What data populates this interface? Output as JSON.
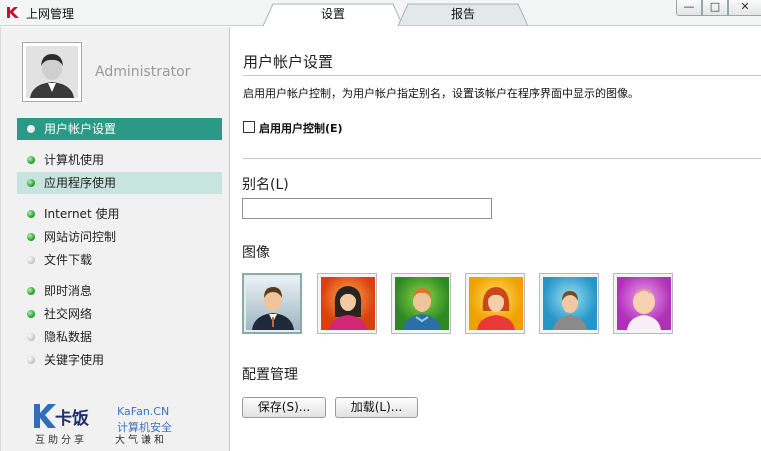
{
  "window": {
    "title": "上网管理",
    "controls": {
      "minimize": "—",
      "maximize": "□",
      "close": "✕"
    }
  },
  "tabs": [
    {
      "label": "设置",
      "active": true
    },
    {
      "label": "报告",
      "active": false
    }
  ],
  "sidebar": {
    "user_name": "Administrator",
    "items": [
      {
        "label": "用户帐户设置",
        "status": "white",
        "state": "active"
      },
      {
        "label": "计算机使用",
        "status": "green",
        "state": "normal"
      },
      {
        "label": "应用程序使用",
        "status": "green",
        "state": "highlighted"
      },
      {
        "label": "Internet 使用",
        "status": "green",
        "state": "normal"
      },
      {
        "label": "网站访问控制",
        "status": "green",
        "state": "normal"
      },
      {
        "label": "文件下载",
        "status": "gray",
        "state": "normal"
      },
      {
        "label": "即时消息",
        "status": "green",
        "state": "normal"
      },
      {
        "label": "社交网络",
        "status": "green",
        "state": "normal"
      },
      {
        "label": "隐私数据",
        "status": "gray",
        "state": "normal"
      },
      {
        "label": "关键字使用",
        "status": "gray",
        "state": "normal"
      }
    ],
    "logo": {
      "cn": "卡饭",
      "en": "KaFan.CN",
      "sub": "计算机安全",
      "motto_left": "互助分享",
      "motto_right": "大气谦和"
    }
  },
  "main": {
    "section_title": "用户帐户设置",
    "description": "启用用户帐户控制，为用户帐户指定别名，设置该帐户在程序界面中显示的图像。",
    "enable_checkbox": {
      "label": "启用用户控制(E)",
      "checked": false
    },
    "alias": {
      "label": "别名(L)",
      "value": ""
    },
    "image_label": "图像",
    "avatars": [
      {
        "name": "businessman-avatar",
        "bg": "#b8c8d0",
        "selected": true
      },
      {
        "name": "woman-dark-hair-avatar",
        "bg": "#e85a1c",
        "selected": false
      },
      {
        "name": "boy-green-avatar",
        "bg": "#3f9f2a",
        "selected": false
      },
      {
        "name": "girl-red-hair-avatar",
        "bg": "#f2b000",
        "selected": false
      },
      {
        "name": "boy-blue-avatar",
        "bg": "#35a9d8",
        "selected": false
      },
      {
        "name": "baby-purple-avatar",
        "bg": "#c040c8",
        "selected": false
      }
    ],
    "config_label": "配置管理",
    "buttons": {
      "save": "保存(S)...",
      "load": "加载(L)..."
    }
  },
  "colors": {
    "accent": "#2a9a86",
    "highlight": "#c8e4df",
    "status_green": "#2aa52f",
    "status_gray": "#c9c9c9"
  }
}
